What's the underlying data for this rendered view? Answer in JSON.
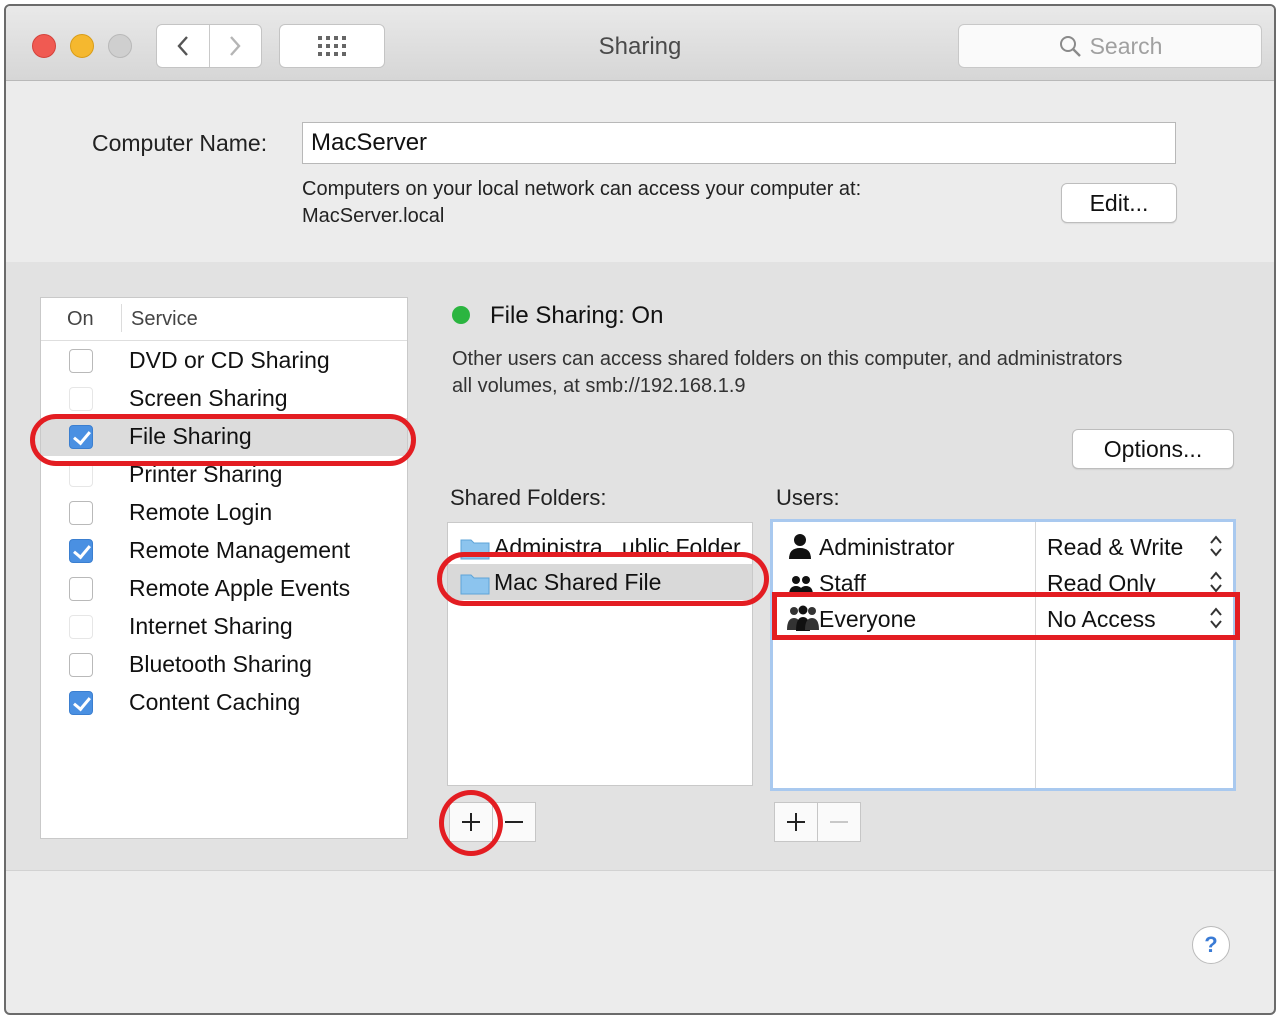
{
  "window": {
    "title": "Sharing"
  },
  "search": {
    "placeholder": "Search"
  },
  "computer_name": {
    "label": "Computer Name:",
    "value": "MacServer",
    "info_line1": "Computers on your local network can access your computer at:",
    "info_line2": "MacServer.local",
    "edit_label": "Edit..."
  },
  "services": {
    "header_on": "On",
    "header_service": "Service",
    "items": [
      {
        "label": "DVD or CD Sharing",
        "checked": false
      },
      {
        "label": "Screen Sharing",
        "checked": false
      },
      {
        "label": "File Sharing",
        "checked": true
      },
      {
        "label": "Printer Sharing",
        "checked": false
      },
      {
        "label": "Remote Login",
        "checked": false
      },
      {
        "label": "Remote Management",
        "checked": true
      },
      {
        "label": "Remote Apple Events",
        "checked": false
      },
      {
        "label": "Internet Sharing",
        "checked": false
      },
      {
        "label": "Bluetooth Sharing",
        "checked": false
      },
      {
        "label": "Content Caching",
        "checked": true
      }
    ]
  },
  "status": {
    "title": "File Sharing: On",
    "color": "#2bb540",
    "description_line1": "Other users can access shared folders on this computer, and administrators",
    "description_line2": "all volumes, at smb://192.168.1.9",
    "options_label": "Options..."
  },
  "shared_folders": {
    "label": "Shared Folders:",
    "items": [
      "Administra...ublic Folder",
      "Mac Shared File"
    ]
  },
  "users": {
    "label": "Users:",
    "items": [
      {
        "name": "Administrator",
        "permission": "Read & Write",
        "icon": "single-user-icon"
      },
      {
        "name": "Staff",
        "permission": "Read Only",
        "icon": "group-icon"
      },
      {
        "name": "Everyone",
        "permission": "No Access",
        "icon": "everyone-icon"
      }
    ]
  },
  "help": {
    "label": "?"
  },
  "annotation_color": "#e31d22"
}
